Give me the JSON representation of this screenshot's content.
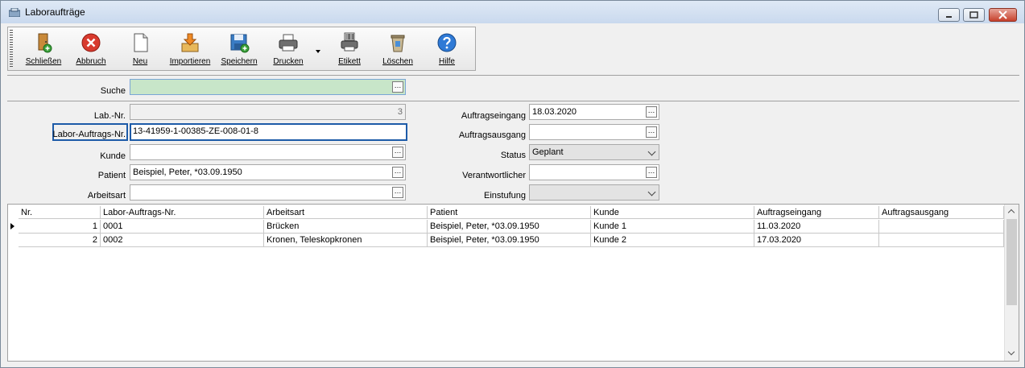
{
  "window": {
    "title": "Laboraufträge"
  },
  "toolbar": {
    "buttons": [
      {
        "label": "Schließen"
      },
      {
        "label": "Abbruch"
      },
      {
        "label": "Neu"
      },
      {
        "label": "Importieren"
      },
      {
        "label": "Speichern"
      },
      {
        "label": "Drucken"
      },
      {
        "label": "Etikett"
      },
      {
        "label": "Löschen"
      },
      {
        "label": "Hilfe"
      }
    ]
  },
  "search": {
    "label": "Suche",
    "value": ""
  },
  "form": {
    "lab_nr": {
      "label": "Lab.-Nr.",
      "value": "3"
    },
    "labor_auftrags_nr": {
      "label": "Labor-Auftrags-Nr.",
      "value": "13-41959-1-00385-ZE-008-01-8"
    },
    "kunde": {
      "label": "Kunde",
      "value": ""
    },
    "patient": {
      "label": "Patient",
      "value": "Beispiel, Peter, *03.09.1950"
    },
    "arbeitsart": {
      "label": "Arbeitsart",
      "value": ""
    },
    "auftragseingang": {
      "label": "Auftragseingang",
      "value": "18.03.2020"
    },
    "auftragsausgang": {
      "label": "Auftragsausgang",
      "value": ""
    },
    "status": {
      "label": "Status",
      "value": "Geplant"
    },
    "verantwortlicher": {
      "label": "Verantwortlicher",
      "value": ""
    },
    "einstufung": {
      "label": "Einstufung",
      "value": ""
    }
  },
  "grid": {
    "columns": [
      "Nr.",
      "Labor-Auftrags-Nr.",
      "Arbeitsart",
      "Patient",
      "Kunde",
      "Auftragseingang",
      "Auftragsausgang"
    ],
    "rows": [
      {
        "nr": "1",
        "auftrags_nr": "0001",
        "arbeitsart": "Brücken",
        "patient": "Beispiel, Peter, *03.09.1950",
        "kunde": "Kunde 1",
        "eingang": "11.03.2020",
        "ausgang": ""
      },
      {
        "nr": "2",
        "auftrags_nr": "0002",
        "arbeitsart": "Kronen, Teleskopkronen",
        "patient": "Beispiel, Peter, *03.09.1950",
        "kunde": "Kunde 2",
        "eingang": "17.03.2020",
        "ausgang": ""
      }
    ]
  },
  "colors": {
    "accent": "#1d5ba8",
    "search_bg": "#c8e6c9",
    "close_red": "#c7412c"
  }
}
